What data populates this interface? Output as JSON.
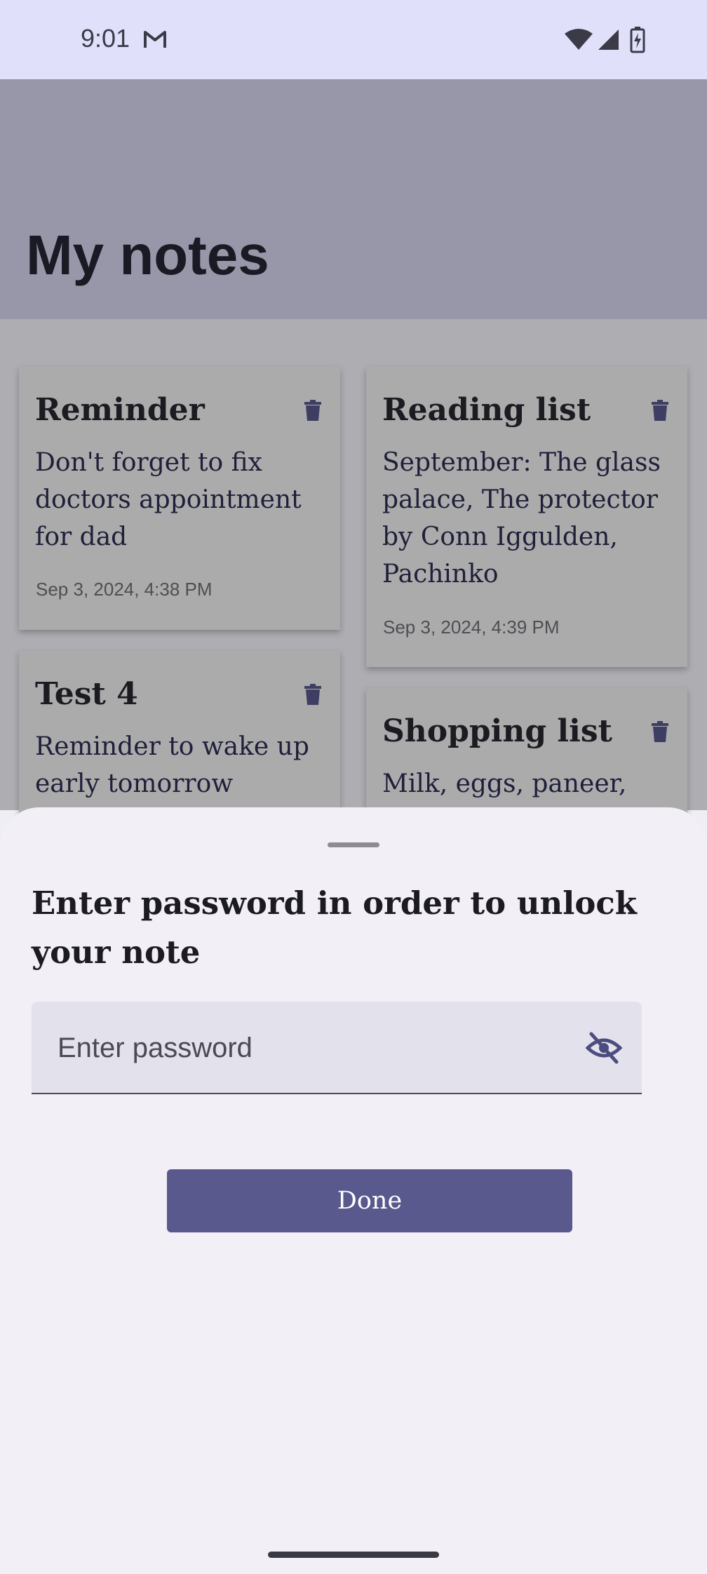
{
  "status_bar": {
    "time": "9:01"
  },
  "app_bar": {
    "title": "My notes"
  },
  "notes": [
    {
      "title": "Reminder",
      "body": "Don't forget to fix doctors appointment for dad",
      "date": "Sep 3, 2024, 4:38 PM"
    },
    {
      "title": "Reading list",
      "body": "September: The glass palace, The protector by Conn Iggulden, Pachinko",
      "date": "Sep 3, 2024, 4:39 PM"
    },
    {
      "title": "Test 4",
      "body": "Reminder to wake up early tomorrow"
    },
    {
      "title": "Shopping list",
      "body": "Milk, eggs, paneer,"
    }
  ],
  "sheet": {
    "title": "Enter password in order to unlock your note",
    "password_placeholder": "Enter password",
    "done_label": "Done"
  },
  "icons": {
    "status": [
      "gmail-icon",
      "wifi-icon",
      "signal-icon",
      "battery-charging-icon"
    ],
    "note_action": "trash-icon",
    "password_toggle": "eye-off-icon"
  },
  "colors": {
    "status_bar_bg": "#e1e0fb",
    "accent": "#59598e",
    "sheet_bg": "#f2eff6"
  }
}
